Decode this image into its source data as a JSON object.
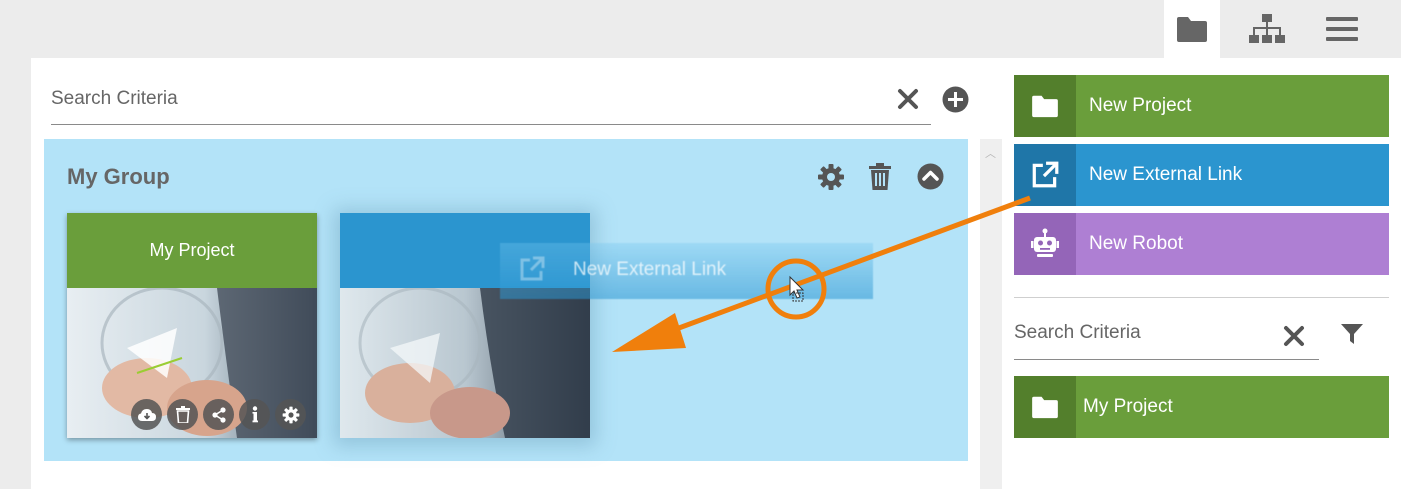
{
  "top_tabs": [
    {
      "name": "folder-tab",
      "icon": "folder-icon",
      "active": true
    },
    {
      "name": "sitemap-tab",
      "icon": "sitemap-icon",
      "active": false
    },
    {
      "name": "menu-tab",
      "icon": "hamburger-menu-icon",
      "active": false
    }
  ],
  "search_left": {
    "placeholder": "Search Criteria"
  },
  "group": {
    "title": "My Group",
    "cards": [
      {
        "title": "My Project",
        "color": "#6a9e3b"
      },
      {
        "title": "",
        "color": "#2b95cf"
      }
    ]
  },
  "drag_ghost": {
    "label": "New External Link"
  },
  "palette": [
    {
      "label": "New Project",
      "icon": "folder-icon",
      "color": "#6a9e3b",
      "icon_bg": "#537f2c"
    },
    {
      "label": "New External Link",
      "icon": "external-link-icon",
      "color": "#2b95cf",
      "icon_bg": "#1f76a8"
    },
    {
      "label": "New Robot",
      "icon": "robot-icon",
      "color": "#ae7fd3",
      "icon_bg": "#9465b8"
    }
  ],
  "search_right": {
    "placeholder": "Search Criteria"
  },
  "project_list": [
    {
      "label": "My Project",
      "icon": "folder-icon",
      "color": "#6a9e3b",
      "icon_bg": "#537f2c"
    }
  ],
  "colors": {
    "accent_orange": "#f07f0c",
    "group_bg": "#b3e3f8"
  }
}
